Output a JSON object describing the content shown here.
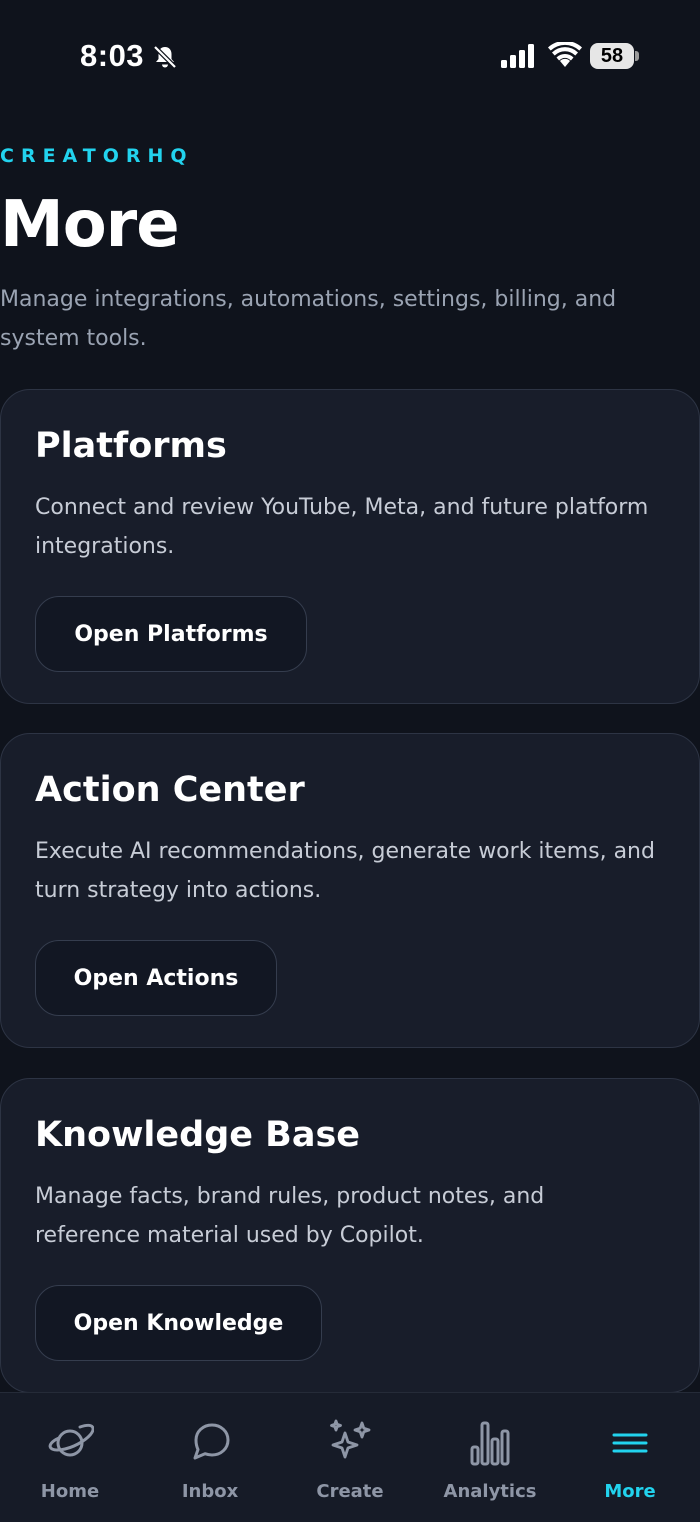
{
  "status_bar": {
    "time": "8:03",
    "battery": "58"
  },
  "header": {
    "brand": "CREATORHQ",
    "title": "More",
    "subtitle": "Manage integrations, automations, settings, billing, and system tools."
  },
  "cards": [
    {
      "title": "Platforms",
      "description": "Connect and review YouTube, Meta, and future platform integrations.",
      "button": "Open Platforms"
    },
    {
      "title": "Action Center",
      "description": "Execute AI recommendations, generate work items, and turn strategy into actions.",
      "button": "Open Actions"
    },
    {
      "title": "Knowledge Base",
      "description": "Manage facts, brand rules, product notes, and reference material used by Copilot.",
      "button": "Open Knowledge"
    }
  ],
  "tab_bar": {
    "tabs": [
      {
        "label": "Home",
        "icon": "planet-icon"
      },
      {
        "label": "Inbox",
        "icon": "chat-bubble-icon"
      },
      {
        "label": "Create",
        "icon": "sparkles-icon"
      },
      {
        "label": "Analytics",
        "icon": "bar-chart-icon"
      },
      {
        "label": "More",
        "icon": "menu-icon"
      }
    ],
    "active": "More"
  },
  "colors": {
    "accent": "#22d3ee",
    "background": "#0f131c",
    "card": "#181d2a",
    "muted_text": "#9aa3b2"
  }
}
